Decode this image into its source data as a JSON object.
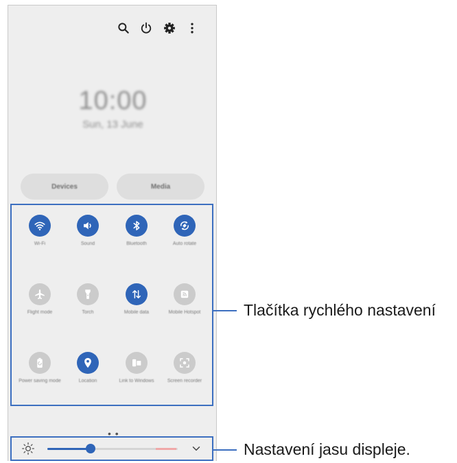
{
  "header": {
    "icons": [
      "search-icon",
      "power-icon",
      "gear-icon",
      "more-vert-icon"
    ]
  },
  "lockscreen": {
    "time": "10:00",
    "date": "Sun, 13 June"
  },
  "buttons": {
    "devices_label": "Devices",
    "media_label": "Media"
  },
  "quick_settings": {
    "row1": [
      {
        "label": "Wi-Fi",
        "icon": "wifi-icon",
        "state": "on"
      },
      {
        "label": "Sound",
        "icon": "sound-icon",
        "state": "on"
      },
      {
        "label": "Bluetooth",
        "icon": "bluetooth-icon",
        "state": "on"
      },
      {
        "label": "Auto rotate",
        "icon": "auto-rotate-icon",
        "state": "on"
      }
    ],
    "row2": [
      {
        "label": "Flight mode",
        "icon": "airplane-icon",
        "state": "off"
      },
      {
        "label": "Torch",
        "icon": "torch-icon",
        "state": "off"
      },
      {
        "label": "Mobile data",
        "icon": "mobile-data-icon",
        "state": "on"
      },
      {
        "label": "Mobile Hotspot",
        "icon": "hotspot-icon",
        "state": "off"
      }
    ],
    "row3": [
      {
        "label": "Power saving mode",
        "icon": "battery-icon",
        "state": "off"
      },
      {
        "label": "Location",
        "icon": "location-icon",
        "state": "on"
      },
      {
        "label": "Link to Windows",
        "icon": "link-windows-icon",
        "state": "off"
      },
      {
        "label": "Screen recorder",
        "icon": "screen-recorder-icon",
        "state": "off"
      }
    ]
  },
  "pager": "• •",
  "brightness": {
    "level_percent": 33,
    "icon": "sun-icon"
  },
  "callouts": {
    "quick_settings": "Tlačítka rychlého nastavení",
    "brightness": "Nastavení jasu displeje."
  },
  "colors": {
    "accent": "#2f65b8",
    "frame": "#3c6fc0",
    "tile_off": "#cbcbcb",
    "panel_bg": "#eeeeee"
  }
}
